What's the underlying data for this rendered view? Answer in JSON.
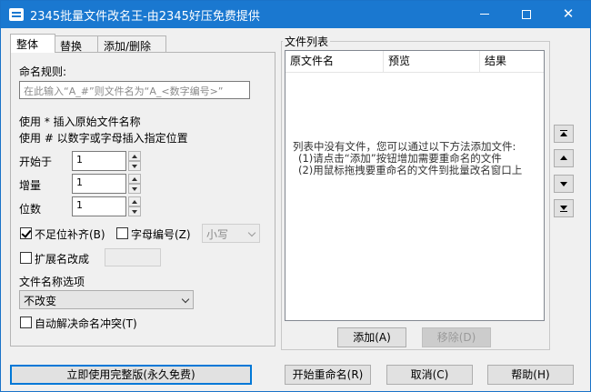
{
  "window": {
    "title": "2345批量文件改名王-由2345好压免费提供",
    "minimize": "—",
    "close": "✕"
  },
  "tabs": [
    "整体",
    "替换",
    "添加/删除"
  ],
  "general": {
    "rule_label": "命名规则:",
    "rule_placeholder": "在此输入“A_#”则文件名为“A_<数字编号>”",
    "hint1": "使用 * 插入原始文件名称",
    "hint2": "使用 # 以数字或字母插入指定位置",
    "start_label": "开始于",
    "start_value": "1",
    "step_label": "增量",
    "step_value": "1",
    "digits_label": "位数",
    "digits_value": "1",
    "pad_label": "不足位补齐(B)",
    "pad_checked": true,
    "letter_label": "字母编号(Z)",
    "letter_checked": false,
    "case_value": "小写",
    "ext_label": "扩展名改成",
    "ext_checked": false,
    "name_option_label": "文件名称选项",
    "name_option_value": "不改变",
    "auto_resolve_label": "自动解决命名冲突(T)",
    "auto_resolve_checked": false
  },
  "file_list": {
    "group_title": "文件列表",
    "columns": [
      "原文件名",
      "预览",
      "结果"
    ],
    "empty_lines": [
      "列表中没有文件，您可以通过以下方法添加文件:",
      "(1)请点击“添加”按钮增加需要重命名的文件",
      "(2)用鼠标拖拽要重命名的文件到批量改名窗口上"
    ],
    "add_button": "添加(A)",
    "remove_button": "移除(D)"
  },
  "footer": {
    "full_version_button": "立即使用完整版(永久免费)",
    "start_button": "开始重命名(R)",
    "cancel_button": "取消(C)",
    "help_button": "帮助(H)"
  },
  "icons": {
    "app": "app-icon",
    "move_top": "move-top-icon",
    "move_up": "move-up-icon",
    "move_down": "move-down-icon",
    "move_bottom": "move-bottom-icon"
  },
  "colors": {
    "titlebar": "#1a78d0",
    "focus_border": "#0078d7"
  }
}
